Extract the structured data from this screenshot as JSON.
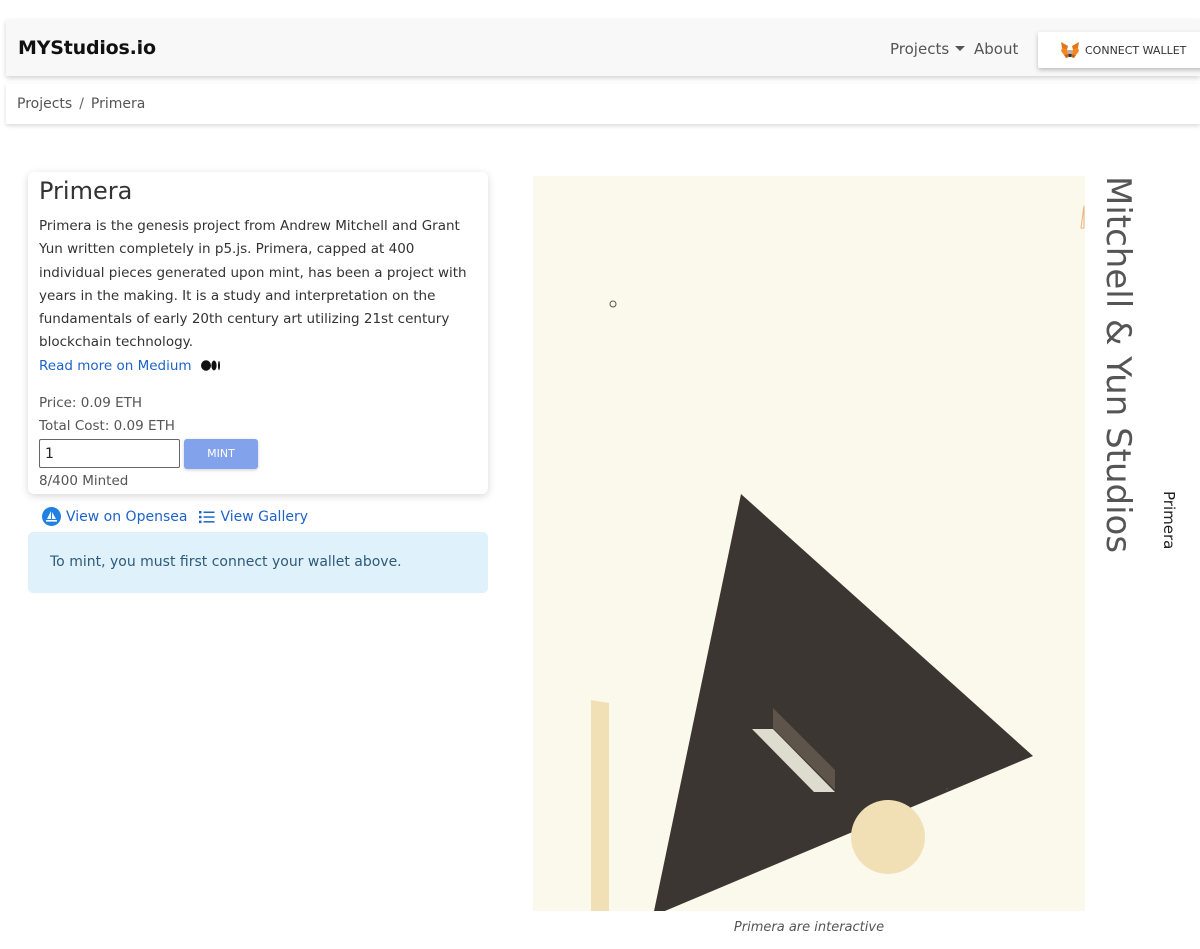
{
  "navbar": {
    "brand": "MYStudios.io",
    "projects_label": "Projects",
    "about_label": "About",
    "connect_wallet_label": "CONNECT WALLET"
  },
  "breadcrumb": {
    "root": "Projects",
    "separator": "/",
    "current": "Primera"
  },
  "project": {
    "title": "Primera",
    "description": "Primera is the genesis project from Andrew Mitchell and Grant Yun written completely in p5.js. Primera, capped at 400 individual pieces generated upon mint, has been a project with years in the making. It is a study and interpretation on the fundamentals of early 20th century art utilizing 21st century blockchain technology.",
    "medium_link": "Read more on Medium",
    "price": "Price: 0.09 ETH",
    "total_cost": "Total Cost: 0.09 ETH",
    "quantity_value": "1",
    "mint_label": "MINT",
    "minted_count": "8/400 Minted"
  },
  "links": {
    "opensea": "View on Opensea",
    "gallery": "View Gallery"
  },
  "alert": {
    "message": "To mint, you must first connect your wallet above."
  },
  "artwork": {
    "caption": "Primera are interactive",
    "studio_name": "Mitchell & Yun Studios",
    "project_name": "Primera"
  },
  "colors": {
    "link": "#1e63c9",
    "mint_button": "#82a2ec",
    "alert_bg": "#dff1fb",
    "canvas_bg": "#fbf8ec",
    "triangle": "#3b3632",
    "accent_cream": "#f1e0b5"
  },
  "icons": {
    "wallet": "metamask-fox-icon",
    "medium": "medium-icon",
    "opensea": "opensea-icon",
    "gallery": "list-icon",
    "projects_dropdown": "caret-down-icon"
  }
}
